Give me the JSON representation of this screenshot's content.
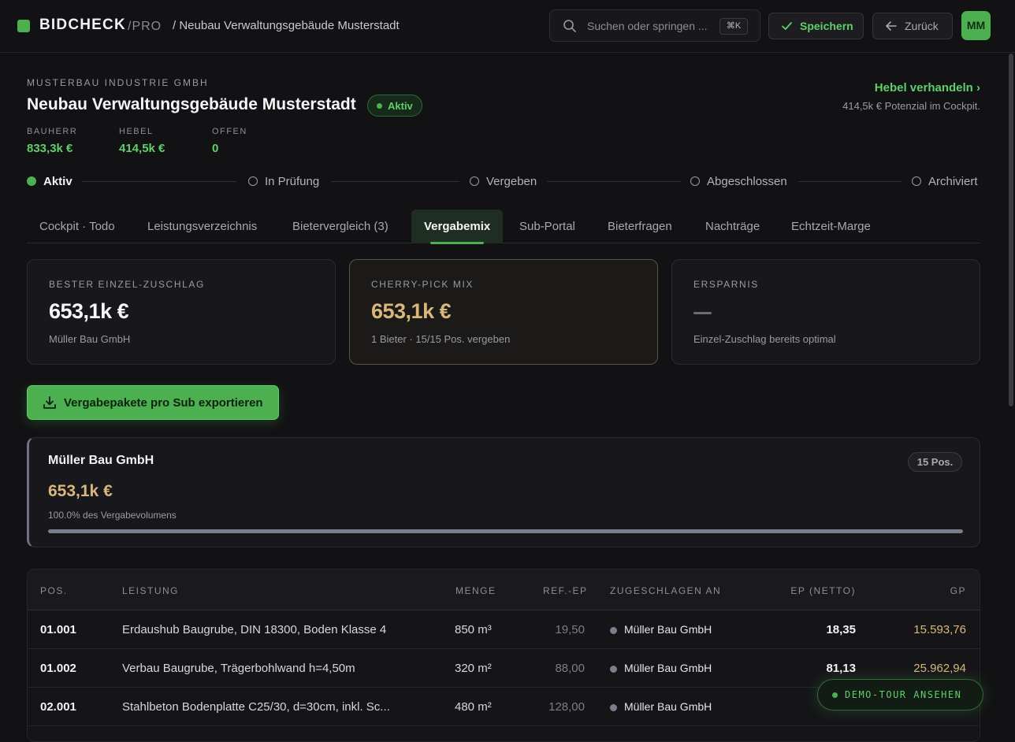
{
  "app": {
    "brand": "BIDCHECK",
    "brand_suffix": "/PRO",
    "breadcrumb": "/ Neubau Verwaltungsgebäude Musterstadt"
  },
  "search": {
    "placeholder": "Suchen oder springen ...",
    "shortcut": "⌘K"
  },
  "toolbar": {
    "save_label": "Speichern",
    "back_label": "Zurück",
    "avatar": "MM"
  },
  "project": {
    "company": "MUSTERBAU INDUSTRIE GMBH",
    "title": "Neubau Verwaltungsgebäude Musterstadt",
    "status": "Aktiv",
    "stats": [
      {
        "label": "BAUHERR",
        "value": "833,3k €"
      },
      {
        "label": "HEBEL",
        "value": "414,5k €"
      },
      {
        "label": "OFFEN",
        "value": "0"
      }
    ],
    "hebel_link": "Hebel verhandeln ›",
    "hebel_sub": "414,5k € Potenzial im Cockpit."
  },
  "steps": [
    "Aktiv",
    "In Prüfung",
    "Vergeben",
    "Abgeschlossen",
    "Archiviert"
  ],
  "tabs": [
    "Cockpit · Todo",
    "Leistungsverzeichnis",
    "Bietervergleich (3)",
    "Vergabemix",
    "Sub-Portal",
    "Bieterfragen",
    "Nachträge",
    "Echtzeit-Marge"
  ],
  "active_tab": "Vergabemix",
  "cards": [
    {
      "label": "BESTER EINZEL-ZUSCHLAG",
      "value": "653,1k €",
      "sub": "Müller Bau GmbH"
    },
    {
      "label": "CHERRY-PICK MIX",
      "value": "653,1k €",
      "sub": "1 Bieter · 15/15 Pos. vergeben"
    },
    {
      "label": "ERSPARNIS",
      "value": "",
      "sub": "Einzel-Zuschlag bereits optimal"
    }
  ],
  "export_label": "Vergabepakete pro Sub exportieren",
  "sub_card": {
    "name": "Müller Bau GmbH",
    "positions": "15 Pos.",
    "value": "653,1k €",
    "percent_text": "100.0% des Vergabevolumens",
    "share": 1.0
  },
  "table": {
    "headers": [
      "POS.",
      "LEISTUNG",
      "MENGE",
      "REF.-EP",
      "ZUGESCHLAGEN AN",
      "EP (NETTO)",
      "GP"
    ],
    "rows": [
      {
        "pos": "01.001",
        "leistung": "Erdaushub Baugrube, DIN 18300, Boden Klasse 4",
        "menge": "850 m³",
        "ref": "19,50",
        "bieter": "Müller Bau GmbH",
        "ep": "18,35",
        "gp": "15.593,76"
      },
      {
        "pos": "01.002",
        "leistung": "Verbau Baugrube, Trägerbohlwand h=4,50m",
        "menge": "320 m²",
        "ref": "88,00",
        "bieter": "Müller Bau GmbH",
        "ep": "81,13",
        "gp": "25.962,94"
      },
      {
        "pos": "02.001",
        "leistung": "Stahlbeton Bodenplatte C25/30, d=30cm, inkl. Sc...",
        "menge": "480 m²",
        "ref": "128,00",
        "bieter": "Müller Bau GmbH",
        "ep": "",
        "gp": ""
      }
    ]
  },
  "demo_label": "DEMO-TOUR ANSEHEN",
  "colors": {
    "accent": "#4caf50",
    "gold": "#d9b77c",
    "bg": "#121214"
  }
}
